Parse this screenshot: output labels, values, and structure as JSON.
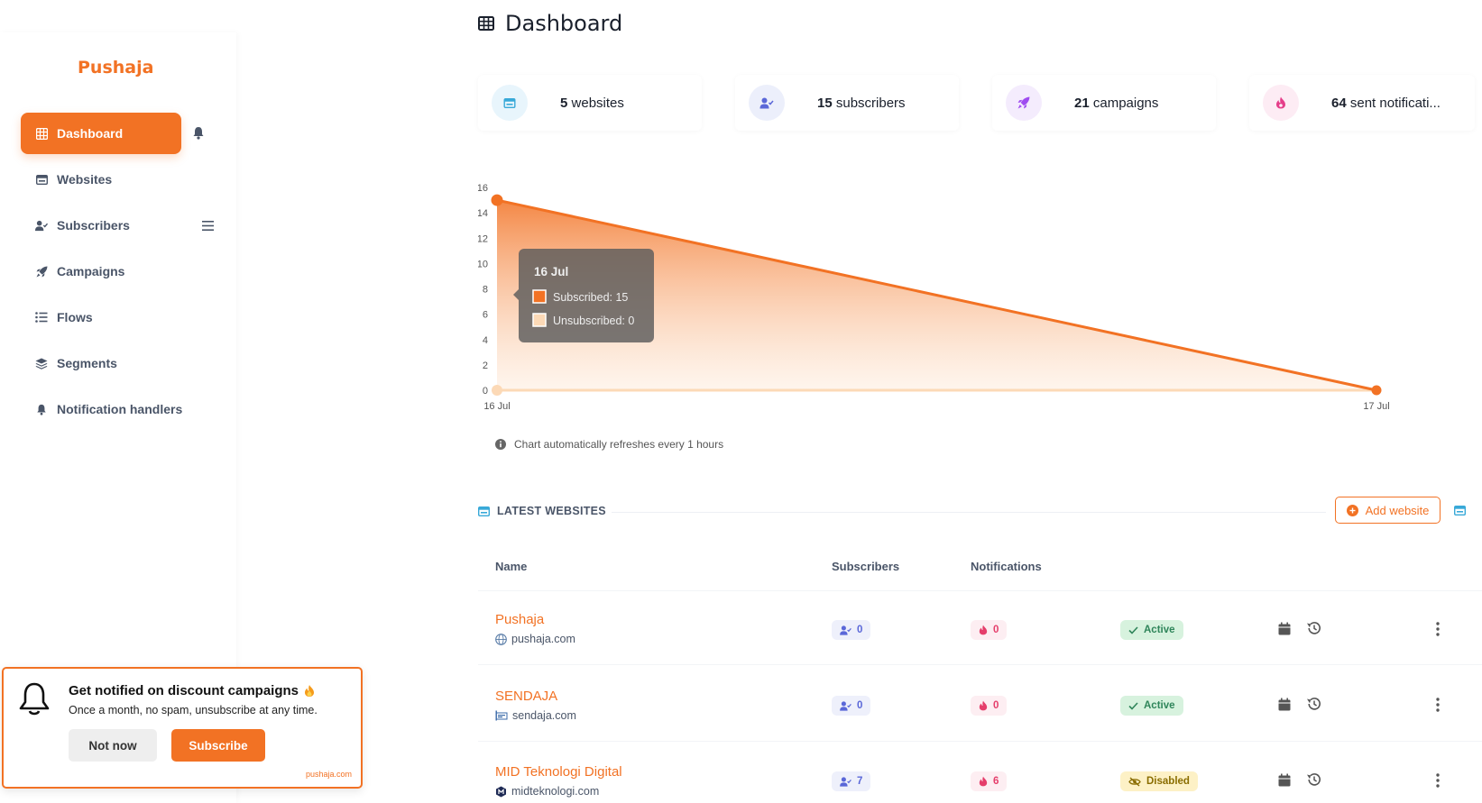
{
  "brand": "Pushaja",
  "sidebar": {
    "items": [
      {
        "label": "Dashboard",
        "icon": "grid-icon",
        "active": true
      },
      {
        "label": "Websites",
        "icon": "window-icon"
      },
      {
        "label": "Subscribers",
        "icon": "user-check-icon"
      },
      {
        "label": "Campaigns",
        "icon": "rocket-icon"
      },
      {
        "label": "Flows",
        "icon": "list-icon"
      },
      {
        "label": "Segments",
        "icon": "layers-icon"
      },
      {
        "label": "Notification handlers",
        "icon": "bell-icon"
      }
    ]
  },
  "header": {
    "title": "Dashboard",
    "icon": "grid-icon"
  },
  "stats": [
    {
      "value": "5",
      "label": "websites",
      "icon": "window-icon",
      "color": "#38a9d8"
    },
    {
      "value": "15",
      "label": "subscribers",
      "icon": "user-check-icon",
      "color": "#5a67d8"
    },
    {
      "value": "21",
      "label": "campaigns",
      "icon": "rocket-icon",
      "color": "#9f4cf0"
    },
    {
      "value": "64",
      "label": "sent notificati...",
      "icon": "fire-icon",
      "color": "#e53e8a"
    }
  ],
  "chart_data": {
    "type": "area",
    "x": [
      "16 Jul",
      "17 Jul"
    ],
    "series": [
      {
        "name": "Subscribed",
        "values": [
          15,
          0
        ],
        "color": "#f27224"
      },
      {
        "name": "Unsubscribed",
        "values": [
          0,
          0
        ],
        "color": "#fcd9b6"
      }
    ],
    "yticks": [
      0,
      2,
      4,
      6,
      8,
      10,
      12,
      14,
      16
    ],
    "ylim": [
      0,
      16
    ],
    "tooltip": {
      "title": "16 Jul",
      "lines": [
        "Subscribed: 15",
        "Unsubscribed: 0"
      ]
    },
    "note": "Chart automatically refreshes every 1 hours"
  },
  "latest_websites": {
    "title": "LATEST WEBSITES",
    "add_label": "Add website",
    "columns": [
      "Name",
      "Subscribers",
      "Notifications"
    ],
    "rows": [
      {
        "name": "Pushaja",
        "domain": "pushaja.com",
        "subscribers": "0",
        "notifications": "0",
        "status": "Active"
      },
      {
        "name": "SENDAJA",
        "domain": "sendaja.com",
        "subscribers": "0",
        "notifications": "0",
        "status": "Active"
      },
      {
        "name": "MID Teknologi Digital",
        "domain": "midteknologi.com",
        "subscribers": "7",
        "notifications": "6",
        "status": "Disabled"
      }
    ]
  },
  "popup": {
    "title": "Get notified on discount campaigns",
    "text": "Once a month, no spam, unsubscribe at any time.",
    "not_now": "Not now",
    "subscribe": "Subscribe",
    "brand": "pushaja.com"
  },
  "colors": {
    "accent": "#f27224"
  }
}
